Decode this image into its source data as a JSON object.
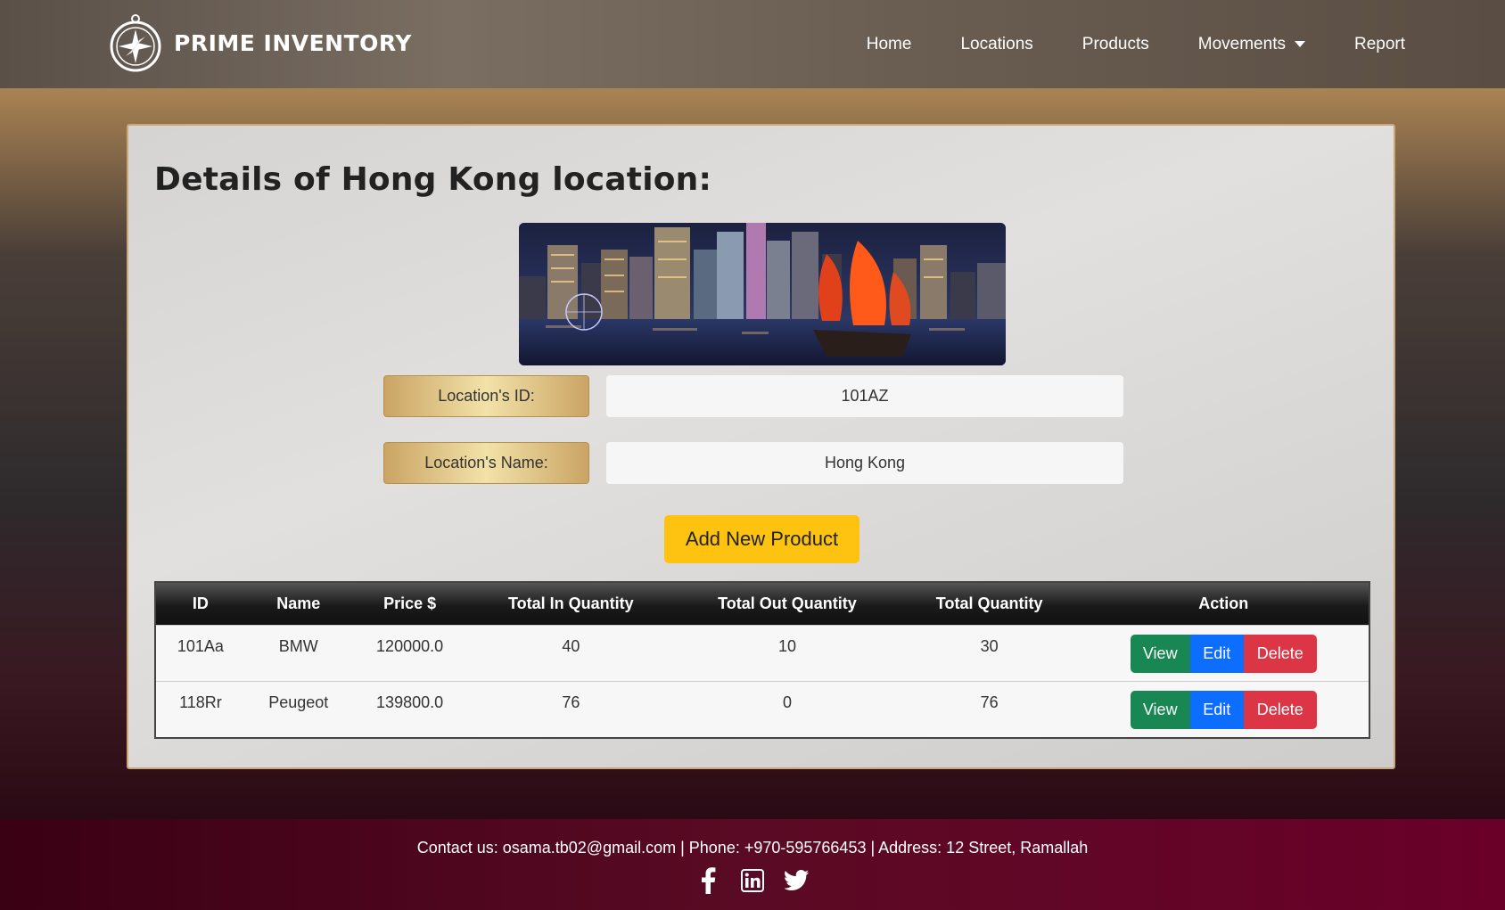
{
  "navbar": {
    "brand": "PRIME INVENTORY",
    "items": [
      {
        "label": "Home",
        "icon": null
      },
      {
        "label": "Locations",
        "icon": null
      },
      {
        "label": "Products",
        "icon": null
      },
      {
        "label": "Movements",
        "icon": "caret-down-icon"
      },
      {
        "label": "Report",
        "icon": null
      }
    ]
  },
  "page": {
    "title": "Details of Hong Kong location:",
    "fields": [
      {
        "label": "Location's ID:",
        "value": "101AZ"
      },
      {
        "label": "Location's Name:",
        "value": "Hong Kong"
      }
    ],
    "add_button": "Add New Product"
  },
  "table": {
    "headers": [
      "ID",
      "Name",
      "Price $",
      "Total In Quantity",
      "Total Out Quantity",
      "Total Quantity",
      "Action"
    ],
    "rows": [
      {
        "id": "101Aa",
        "name": "BMW",
        "price": "120000.0",
        "in": "40",
        "out": "10",
        "total": "30"
      },
      {
        "id": "118Rr",
        "name": "Peugeot",
        "price": "139800.0",
        "in": "76",
        "out": "0",
        "total": "76"
      }
    ],
    "actions": {
      "view": "View",
      "edit": "Edit",
      "delete": "Delete"
    }
  },
  "footer": {
    "contact": "Contact us: osama.tb02@gmail.com | Phone: +970-595766453 | Address: 12 Street, Ramallah",
    "social": [
      "facebook-icon",
      "linkedin-icon",
      "twitter-icon"
    ]
  },
  "colors": {
    "accent_yellow": "#fec210",
    "view_green": "#198754",
    "edit_blue": "#0d6efd",
    "delete_red": "#dc3545",
    "footer": "#5a0a24"
  }
}
